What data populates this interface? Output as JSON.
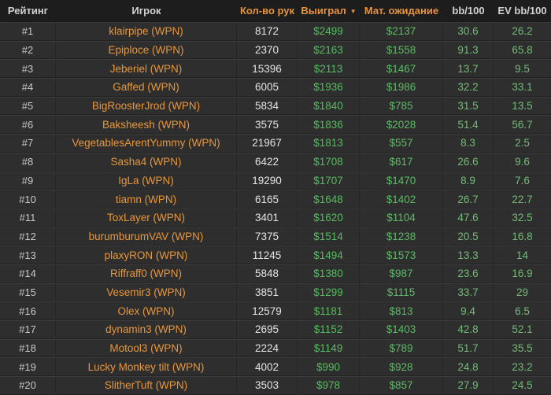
{
  "table": {
    "columns": [
      {
        "id": "rank",
        "label": "Рейтинг"
      },
      {
        "id": "player",
        "label": "Игрок"
      },
      {
        "id": "hands",
        "label": "Кол-во рук"
      },
      {
        "id": "won",
        "label": "Выиграл"
      },
      {
        "id": "ev_usd",
        "label": "Мат. ожидание"
      },
      {
        "id": "bb100",
        "label": "bb/100"
      },
      {
        "id": "ev_bb100",
        "label": "EV bb/100"
      }
    ],
    "sort": {
      "column": "won",
      "direction": "desc",
      "icon": "▼"
    },
    "rows": [
      {
        "rank": "#1",
        "player": "klairpipe (WPN)",
        "hands": "8172",
        "won": "$2499",
        "ev_usd": "$2137",
        "bb100": "30.6",
        "ev_bb100": "26.2"
      },
      {
        "rank": "#2",
        "player": "Epiploce (WPN)",
        "hands": "2370",
        "won": "$2163",
        "ev_usd": "$1558",
        "bb100": "91.3",
        "ev_bb100": "65.8"
      },
      {
        "rank": "#3",
        "player": "Jeberiel (WPN)",
        "hands": "15396",
        "won": "$2113",
        "ev_usd": "$1467",
        "bb100": "13.7",
        "ev_bb100": "9.5"
      },
      {
        "rank": "#4",
        "player": "Gaffed (WPN)",
        "hands": "6005",
        "won": "$1936",
        "ev_usd": "$1986",
        "bb100": "32.2",
        "ev_bb100": "33.1"
      },
      {
        "rank": "#5",
        "player": "BigRoosterJrod (WPN)",
        "hands": "5834",
        "won": "$1840",
        "ev_usd": "$785",
        "bb100": "31.5",
        "ev_bb100": "13.5"
      },
      {
        "rank": "#6",
        "player": "Baksheesh (WPN)",
        "hands": "3575",
        "won": "$1836",
        "ev_usd": "$2028",
        "bb100": "51.4",
        "ev_bb100": "56.7"
      },
      {
        "rank": "#7",
        "player": "VegetablesArentYummy (WPN)",
        "hands": "21967",
        "won": "$1813",
        "ev_usd": "$557",
        "bb100": "8.3",
        "ev_bb100": "2.5"
      },
      {
        "rank": "#8",
        "player": "Sasha4 (WPN)",
        "hands": "6422",
        "won": "$1708",
        "ev_usd": "$617",
        "bb100": "26.6",
        "ev_bb100": "9.6"
      },
      {
        "rank": "#9",
        "player": "IgLa (WPN)",
        "hands": "19290",
        "won": "$1707",
        "ev_usd": "$1470",
        "bb100": "8.9",
        "ev_bb100": "7.6"
      },
      {
        "rank": "#10",
        "player": "tiamn (WPN)",
        "hands": "6165",
        "won": "$1648",
        "ev_usd": "$1402",
        "bb100": "26.7",
        "ev_bb100": "22.7"
      },
      {
        "rank": "#11",
        "player": "ToxLayer (WPN)",
        "hands": "3401",
        "won": "$1620",
        "ev_usd": "$1104",
        "bb100": "47.6",
        "ev_bb100": "32.5"
      },
      {
        "rank": "#12",
        "player": "burumburumVAV (WPN)",
        "hands": "7375",
        "won": "$1514",
        "ev_usd": "$1238",
        "bb100": "20.5",
        "ev_bb100": "16.8"
      },
      {
        "rank": "#13",
        "player": "plaxyRON (WPN)",
        "hands": "11245",
        "won": "$1494",
        "ev_usd": "$1573",
        "bb100": "13.3",
        "ev_bb100": "14"
      },
      {
        "rank": "#14",
        "player": "Riffraff0 (WPN)",
        "hands": "5848",
        "won": "$1380",
        "ev_usd": "$987",
        "bb100": "23.6",
        "ev_bb100": "16.9"
      },
      {
        "rank": "#15",
        "player": "Vesemir3 (WPN)",
        "hands": "3851",
        "won": "$1299",
        "ev_usd": "$1115",
        "bb100": "33.7",
        "ev_bb100": "29"
      },
      {
        "rank": "#16",
        "player": "Olex (WPN)",
        "hands": "12579",
        "won": "$1181",
        "ev_usd": "$813",
        "bb100": "9.4",
        "ev_bb100": "6.5"
      },
      {
        "rank": "#17",
        "player": "dynamin3 (WPN)",
        "hands": "2695",
        "won": "$1152",
        "ev_usd": "$1403",
        "bb100": "42.8",
        "ev_bb100": "52.1"
      },
      {
        "rank": "#18",
        "player": "Motool3 (WPN)",
        "hands": "2224",
        "won": "$1149",
        "ev_usd": "$789",
        "bb100": "51.7",
        "ev_bb100": "35.5"
      },
      {
        "rank": "#19",
        "player": "Lucky Monkey tilt (WPN)",
        "hands": "4002",
        "won": "$990",
        "ev_usd": "$928",
        "bb100": "24.8",
        "ev_bb100": "23.2"
      },
      {
        "rank": "#20",
        "player": "SlitherTuft (WPN)",
        "hands": "3503",
        "won": "$978",
        "ev_usd": "$857",
        "bb100": "27.9",
        "ev_bb100": "24.5"
      }
    ]
  },
  "colors": {
    "header_bg": "#1c1d1c",
    "row_bg": "#2d2e2d",
    "accent_orange": "#e8923c",
    "money_green": "#58bb62",
    "bb_green": "#74ba79"
  }
}
